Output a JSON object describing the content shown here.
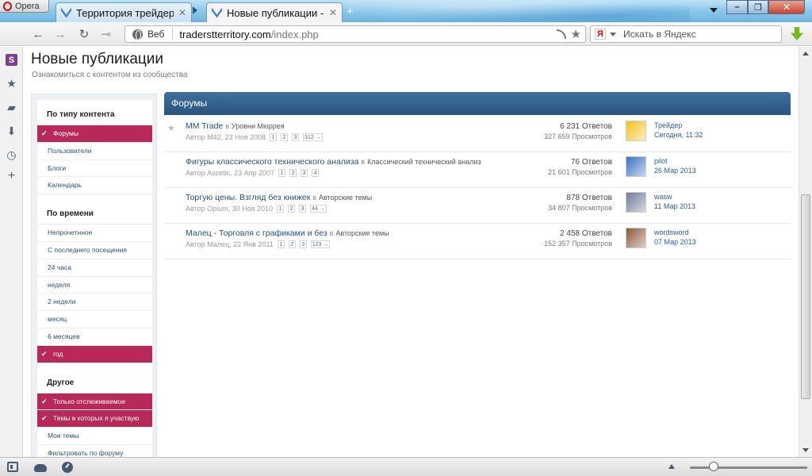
{
  "browser": {
    "opera_label": "Opera",
    "tabs": [
      {
        "title": "Территория трейдеро..."
      },
      {
        "title": "Новые публикации - ..."
      }
    ],
    "close_glyph": "✕",
    "new_tab_glyph": "+",
    "address": {
      "web_label": "Веб",
      "domain": "traderstterritory.com",
      "path": "/index.php"
    },
    "search": {
      "engine_glyph": "Я",
      "placeholder": "Искать в Яндекс"
    },
    "zoom_fraction": 0.2
  },
  "icons": {
    "back": "back-arrow-icon",
    "forward": "forward-arrow-icon",
    "reload": "reload-icon",
    "key": "key-icon",
    "speed_dial": "speed-dial-icon",
    "bookmarks": "star-icon",
    "notes": "notes-icon",
    "downloads": "downloads-icon",
    "history": "history-icon",
    "add_panel": "plus-icon"
  },
  "page": {
    "title": "Новые публикации",
    "subtitle": "Ознакомиться с контентом из сообщества"
  },
  "filters": {
    "sections": [
      {
        "heading": "По типу контента",
        "items": [
          {
            "label": "Форумы",
            "selected": true
          },
          {
            "label": "Пользователи",
            "selected": false
          },
          {
            "label": "Блоги",
            "selected": false
          },
          {
            "label": "Календарь",
            "selected": false
          }
        ]
      },
      {
        "heading": "По времени",
        "items": [
          {
            "label": "Непрочетнное",
            "selected": false
          },
          {
            "label": "С последнего посещения",
            "selected": false
          },
          {
            "label": "24 часа",
            "selected": false
          },
          {
            "label": "неделя",
            "selected": false
          },
          {
            "label": "2 недели",
            "selected": false
          },
          {
            "label": "месяц",
            "selected": false
          },
          {
            "label": "6 месяцев",
            "selected": false
          },
          {
            "label": "год",
            "selected": true
          }
        ]
      },
      {
        "heading": "Другое",
        "items": [
          {
            "label": "Только отслеживаемое",
            "selected": true
          },
          {
            "label": "Темы в которых я участвую",
            "selected": true
          },
          {
            "label": "Мои темы",
            "selected": false
          },
          {
            "label": "Фильтровать по форуму",
            "selected": false
          }
        ]
      }
    ]
  },
  "forums": {
    "header": "Форумы",
    "in_word": "в",
    "topics": [
      {
        "title": "MM Trade",
        "category": "Уровни Мюррея",
        "meta": "Автор M42, 23 Ноя 2008",
        "pages": [
          "1",
          "2",
          "3",
          "312 →"
        ],
        "replies": "6 231 Ответов",
        "views": "327 659 Просмотров",
        "last_user": "Трейдер",
        "last_date": "Сегодня, 11:32",
        "avatar_color": "#f3c21e"
      },
      {
        "title": "Фигуры классического технического анализа",
        "category": "Классический технический анализ",
        "meta": "Автор Ascetic, 23 Апр 2007",
        "pages": [
          "1",
          "2",
          "3",
          "4"
        ],
        "replies": "76 Ответов",
        "views": "21 601 Просмотров",
        "last_user": "pilot",
        "last_date": "26 Мар 2013",
        "avatar_color": "#3b72c2"
      },
      {
        "title": "Торгую цены. Взгляд без книжек",
        "category": "Авторские темы",
        "meta": "Автор Opium, 30 Ноя 2010",
        "pages": [
          "1",
          "2",
          "3",
          "44 →"
        ],
        "replies": "878 Ответов",
        "views": "34 807 Просмотров",
        "last_user": "wasw",
        "last_date": "11 Мар 2013",
        "avatar_color": "#6f7c98"
      },
      {
        "title": "Малец - Торговля с графиками и без",
        "category": "Авторские темы",
        "meta": "Автор Малец, 22 Янв 2011",
        "pages": [
          "1",
          "2",
          "3",
          "123 →"
        ],
        "replies": "2 458 Ответов",
        "views": "152 357 Просмотров",
        "last_user": "wordsword",
        "last_date": "07 Мар 2013",
        "avatar_color": "#8a5a3a"
      }
    ]
  }
}
